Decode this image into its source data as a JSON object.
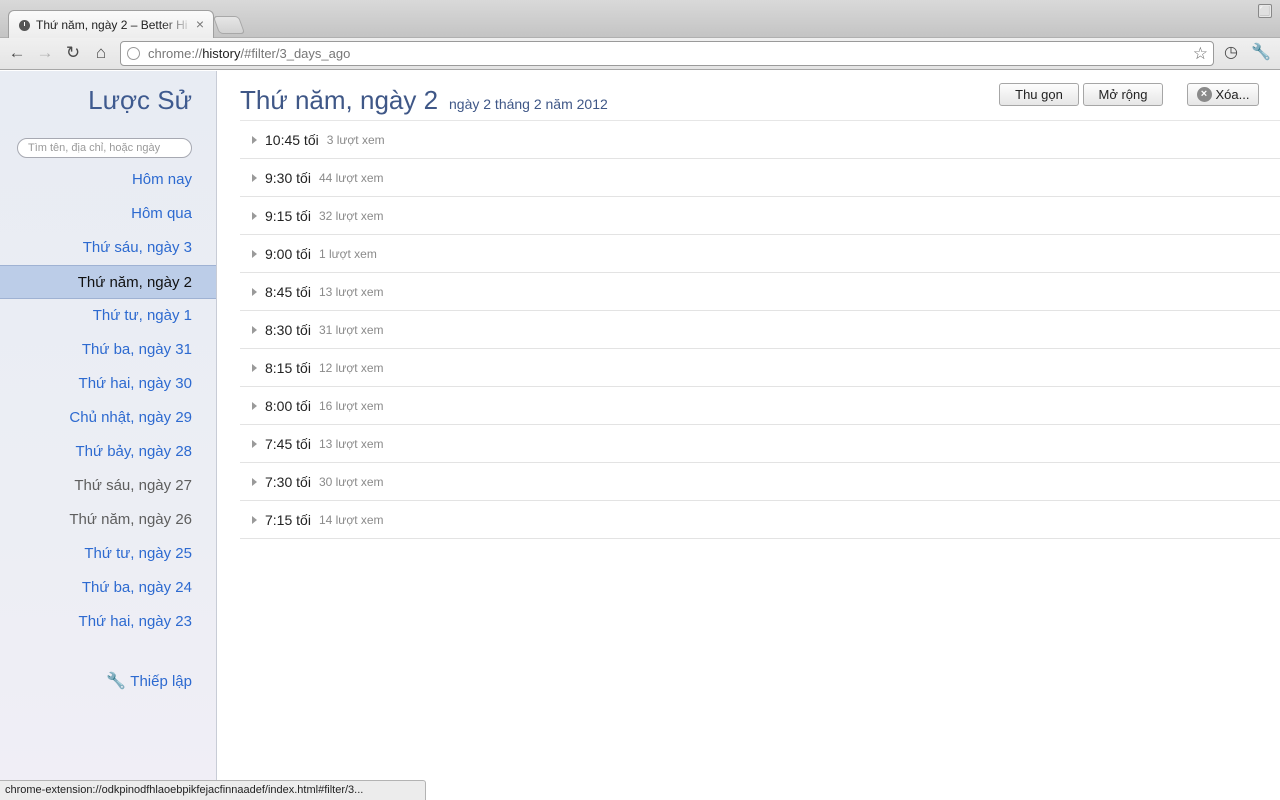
{
  "browser": {
    "tab_title": "Thứ năm, ngày 2 – Better Hi",
    "tab_close": "×",
    "url_scheme": "chrome://",
    "url_host": "history",
    "url_path": "/#filter/3_days_ago"
  },
  "sidebar": {
    "title": "Lược Sử",
    "search_placeholder": "Tìm tên, địa chỉ, hoặc ngày",
    "items": [
      {
        "label": "Hôm nay",
        "state": "link"
      },
      {
        "label": "Hôm qua",
        "state": "link"
      },
      {
        "label": "Thứ sáu, ngày 3",
        "state": "link"
      },
      {
        "label": "Thứ năm, ngày 2",
        "state": "active"
      },
      {
        "label": "Thứ tư, ngày 1",
        "state": "link"
      },
      {
        "label": "Thứ ba, ngày 31",
        "state": "link"
      },
      {
        "label": "Thứ hai, ngày 30",
        "state": "link"
      },
      {
        "label": "Chủ nhật, ngày 29",
        "state": "link"
      },
      {
        "label": "Thứ bảy, ngày 28",
        "state": "link"
      },
      {
        "label": "Thứ sáu, ngày 27",
        "state": "visited"
      },
      {
        "label": "Thứ năm, ngày 26",
        "state": "visited"
      },
      {
        "label": "Thứ tư, ngày 25",
        "state": "link"
      },
      {
        "label": "Thứ ba, ngày 24",
        "state": "link"
      },
      {
        "label": "Thứ hai, ngày 23",
        "state": "link"
      }
    ],
    "settings_label": "Thiếp lập"
  },
  "main": {
    "title": "Thứ năm, ngày 2",
    "subtitle": "ngày 2 tháng 2 năm 2012",
    "collapse_label": "Thu gọn",
    "expand_label": "Mở rộng",
    "clear_label": "Xóa...",
    "rows": [
      {
        "time": "10:45 tối",
        "count": "3 lượt xem"
      },
      {
        "time": "9:30 tối",
        "count": "44 lượt xem"
      },
      {
        "time": "9:15 tối",
        "count": "32 lượt xem"
      },
      {
        "time": "9:00 tối",
        "count": "1 lượt xem"
      },
      {
        "time": "8:45 tối",
        "count": "13 lượt xem"
      },
      {
        "time": "8:30 tối",
        "count": "31 lượt xem"
      },
      {
        "time": "8:15 tối",
        "count": "12 lượt xem"
      },
      {
        "time": "8:00 tối",
        "count": "16 lượt xem"
      },
      {
        "time": "7:45 tối",
        "count": "13 lượt xem"
      },
      {
        "time": "7:30 tối",
        "count": "30 lượt xem"
      },
      {
        "time": "7:15 tối",
        "count": "14 lượt xem"
      }
    ]
  },
  "status_bar": "chrome-extension://odkpinodfhlaoebpikfejacfinnaadef/index.html#filter/3...",
  "colors": {
    "link": "#2d6ad0",
    "visited": "#5e5e5e",
    "active_bg": "#bccde8",
    "title": "#3f5787"
  }
}
